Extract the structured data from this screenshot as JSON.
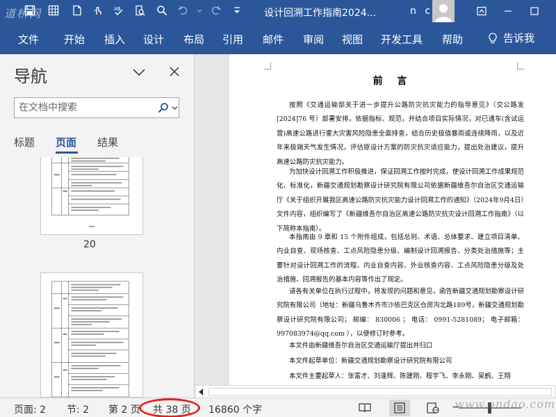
{
  "window": {
    "logo_text": "道桥网",
    "title": "设计回溯工作指南2024...",
    "user_initials": "n c"
  },
  "ribbon": {
    "tabs": [
      "文件",
      "开始",
      "插入",
      "设计",
      "布局",
      "引用",
      "邮件",
      "审阅",
      "视图",
      "开发工具",
      "帮助"
    ],
    "tell_me": "告诉我"
  },
  "nav": {
    "title": "导航",
    "search_placeholder": "在文档中搜索",
    "tabs": [
      "标题",
      "页面",
      "结果"
    ],
    "active_tab": "页面",
    "thumb_page_numbers": [
      "20"
    ]
  },
  "document": {
    "heading": "前 言",
    "paragraphs": [
      "按照《交通运输部关于进一步提升公路防灾抗灾能力的指导意见》（交公路发[2024]76 号）部署安排，依据指标、规范，并结合项目实际情况，对已通车(含试运营)高速公路进行重大灾害风险隐患全面排查，结合历史极值暴雨或连续降雨，以及近年来极端天气发生情况，评估原设计方案的防灾抗灾适应能力，提出处治建议，提升高速公路防灾抗灾能力。",
      "为加快设计回溯工作积极推进，保证回溯工作按时完成，使设计回溯工作成果规范化、标准化，新疆交通规划勘察设计研究院有限公司依据新疆维吾尔自治区交通运输厅《关于组织开展我区高速公路防灾抗灾能力设计回溯工作的通知》（2024年9月4日）文件内容，组织编写了《新疆维吾尔自治区高速公路防灾抗灾设计回溯工作指南》（以下简称本指南）。",
      "本指南由 9 章和 15 个附件组成，包括总则、术语、总体要求、建立项目清单、内业自查、现场核查、工点风险隐患分级、编制设计回溯报告、分类处治措施等；主要针对设计回溯工作的流程、内业自查内容、外业核查内容、工点风险隐患分级及处治措施、回溯报告的基本内容等作出了规定。",
      "请各有关单位在执行过程中，将发现的问题和意见，函告新疆交通规划勘察设计研究院有限公司（地址：新疆乌鲁木齐市沙依巴克区仓房沟北路189号，新疆交通规划勘察设计研究院有限公司； 邮编： 830006 ； 电话： 0991-5281089； 电子邮箱： 997083974@qq.com ），以便修订时参考。",
      "本文件由新疆维吾尔自治区交通运输厅提出并归口",
      "本文件起草单位：新疆交通规划勘察设计研究院有限公司",
      "本文件主要起草人：张富才、刘逢辉、陈建刚、程宇飞、李永刚、吴鹤、王翔"
    ]
  },
  "status": {
    "page": "页面: 2",
    "section": "节: 2",
    "page_of": "第 2 页",
    "total_pages": "共 38 页",
    "word_count": "16860 个字"
  },
  "watermark": "www.ondao.com",
  "colors": {
    "ribbon_blue": "#2b579a",
    "highlight_circle": "#e02020"
  }
}
